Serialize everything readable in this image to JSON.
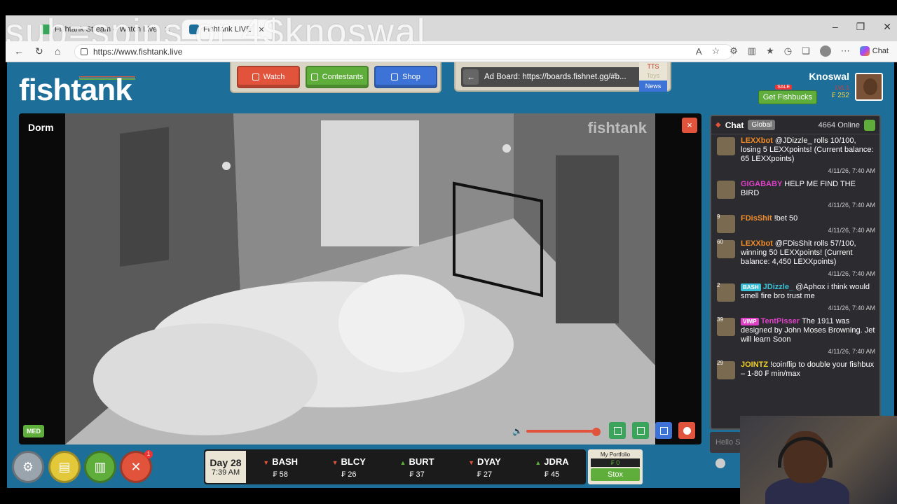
{
  "overlay": {
    "text": "sub=spins or 4$knoswal"
  },
  "browser": {
    "tabs": [
      {
        "label": "Fishtank Stream – Watch Live",
        "active": false
      },
      {
        "label": "Fishtank LIVE",
        "active": true
      }
    ],
    "url": "https://www.fishtank.live",
    "chat_label": "Chat"
  },
  "site": {
    "logo": "fishtank",
    "nav": {
      "watch": "Watch",
      "contestants": "Contestants",
      "shop": "Shop"
    },
    "adboard": {
      "text": "Ad Board: https://boards.fishnet.gg/#b...",
      "tags": [
        "TTS",
        "Toys",
        "News"
      ]
    },
    "user": {
      "name": "Knoswal",
      "sale": "SALE",
      "level": "LVL 1",
      "get_fishbucks": "Get Fishbucks",
      "fishbucks": "₣ 252"
    }
  },
  "video": {
    "room": "Dorm",
    "watermark": "fishtank",
    "quality": "MED",
    "close": "×"
  },
  "chat": {
    "title": "Chat",
    "channel": "Global",
    "online": "4664 Online",
    "input_placeholder": "Hello S",
    "messages": [
      {
        "name": "LEXXbot",
        "name_color": "#f28c28",
        "text": "@JDizzle_ rolls 10/100, losing 5 LEXXpoints! (Current balance: 65 LEXXpoints)",
        "ts": "4/11/26, 7:40 AM",
        "level": "",
        "badge": ""
      },
      {
        "name": "GIGABABY",
        "name_color": "#e040c8",
        "text": "HELP ME FIND THE BIRD",
        "ts": "4/11/26, 7:40 AM",
        "level": "",
        "badge": ""
      },
      {
        "name": "FDisShit",
        "name_color": "#f28c28",
        "text": "!bet 50",
        "ts": "4/11/26, 7:40 AM",
        "level": "9",
        "badge": ""
      },
      {
        "name": "LEXXbot",
        "name_color": "#f28c28",
        "text": "@FDisShit rolls 57/100, winning 50 LEXXpoints! (Current balance: 4,450 LEXXpoints)",
        "ts": "4/11/26, 7:40 AM",
        "level": "60",
        "badge": ""
      },
      {
        "name": "JDizzle_",
        "name_color": "#3ac0d8",
        "text": "@Aphox i think would smell fire bro trust me",
        "ts": "4/11/26, 7:40 AM",
        "level": "2",
        "badge": "BASH",
        "badge_color": "#3ac0d8"
      },
      {
        "name": "TentPisser",
        "name_color": "#e040c8",
        "text": "The 1911 was designed by John Moses Browning. Jet will learn Soon",
        "ts": "4/11/26, 7:40 AM",
        "level": "39",
        "badge": "VIMP",
        "badge_color": "#e040c8"
      },
      {
        "name": "JOINTZ",
        "name_color": "#f2d028",
        "text": "!coinflip to double your fishbux – 1-80 ₣ min/max",
        "ts": "",
        "level": "29",
        "badge": ""
      }
    ]
  },
  "ticker": {
    "day": "Day 28",
    "time": "7:39 AM",
    "stocks": [
      {
        "sym": "BASH",
        "dir": "down",
        "price": "₣ 58"
      },
      {
        "sym": "BLCY",
        "dir": "down",
        "price": "₣ 26"
      },
      {
        "sym": "BURT",
        "dir": "up",
        "price": "₣ 37"
      },
      {
        "sym": "DYAY",
        "dir": "down",
        "price": "₣ 27"
      },
      {
        "sym": "JDRA",
        "dir": "up",
        "price": "₣ 45"
      }
    ],
    "portfolio_label": "My Portfolio",
    "portfolio_value": "₣ 0",
    "stox": "Stox"
  },
  "bottom": {
    "notif_count": "1"
  }
}
